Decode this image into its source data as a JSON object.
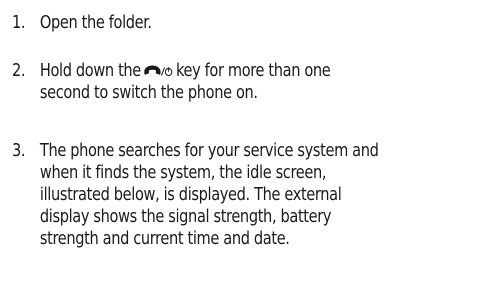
{
  "steps": [
    {
      "number": "1.",
      "lines": [
        "Open the folder."
      ]
    },
    {
      "number": "2.",
      "before_icon": "Hold down the",
      "icon": "end-power-key-icon",
      "after_icon": "key for more than one",
      "line2": "second to switch the phone on."
    },
    {
      "number": "3.",
      "lines": [
        "The phone searches for your service system and",
        "when it finds the system, the idle screen,",
        "illustrated below, is displayed. The external",
        "display shows the signal strength, battery",
        "strength and current time and date."
      ]
    }
  ]
}
